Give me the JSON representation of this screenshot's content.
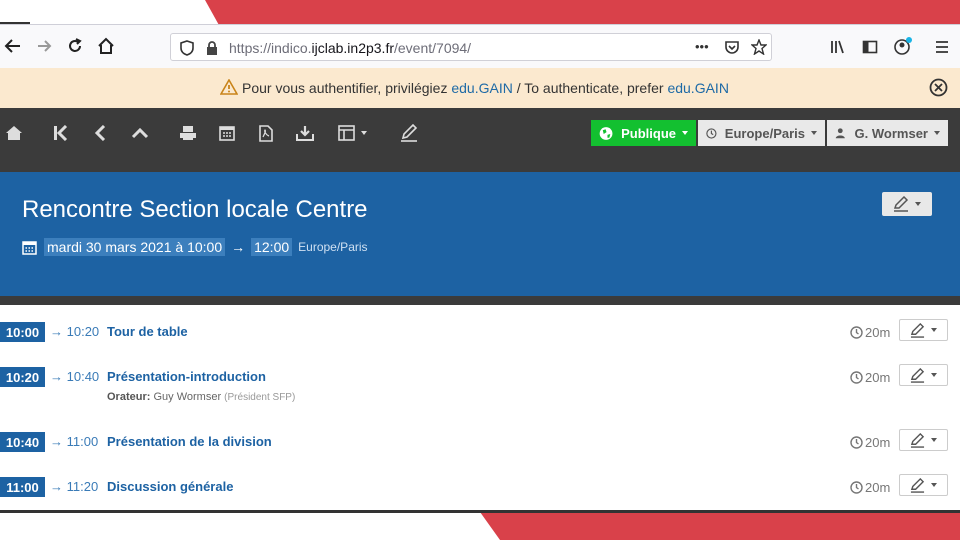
{
  "browser": {
    "url_prefix": "https://indico.",
    "url_domain": "ijclab.in2p3.fr",
    "url_path": "/event/7094/",
    "overflow_label": "•••"
  },
  "notice": {
    "text": "Pour vous authentifier, privilégiez ",
    "link1": "edu.GAIN",
    "middle": " / To authenticate, prefer ",
    "link2": "edu.GAIN"
  },
  "toolbar": {
    "protection_label": "Publique",
    "timezone_label": "Europe/Paris",
    "user_label": "G. Wormser"
  },
  "event": {
    "title": "Rencontre Section locale Centre",
    "date_label": "mardi 30 mars 2021 à 10:00",
    "arrow": "→",
    "end_label": "12:00",
    "timezone": "Europe/Paris"
  },
  "timetable": {
    "arrow": "→",
    "rows": [
      {
        "start": "10:00",
        "end": "10:20",
        "title": "Tour de table",
        "duration": "20m"
      },
      {
        "start": "10:20",
        "end": "10:40",
        "title": "Présentation-introduction",
        "duration": "20m",
        "speaker_label": "Orateur:",
        "speaker": "Guy Wormser",
        "affiliation": "(Président SFP)"
      },
      {
        "start": "10:40",
        "end": "11:00",
        "title": "Présentation de la division",
        "duration": "20m"
      },
      {
        "start": "11:00",
        "end": "11:20",
        "title": "Discussion générale",
        "duration": "20m"
      }
    ]
  },
  "colors": {
    "brand_blue": "#1d62a3",
    "accent_red": "#d9414a",
    "public_green": "#13c030",
    "notice_bg": "#fbe9cf"
  }
}
